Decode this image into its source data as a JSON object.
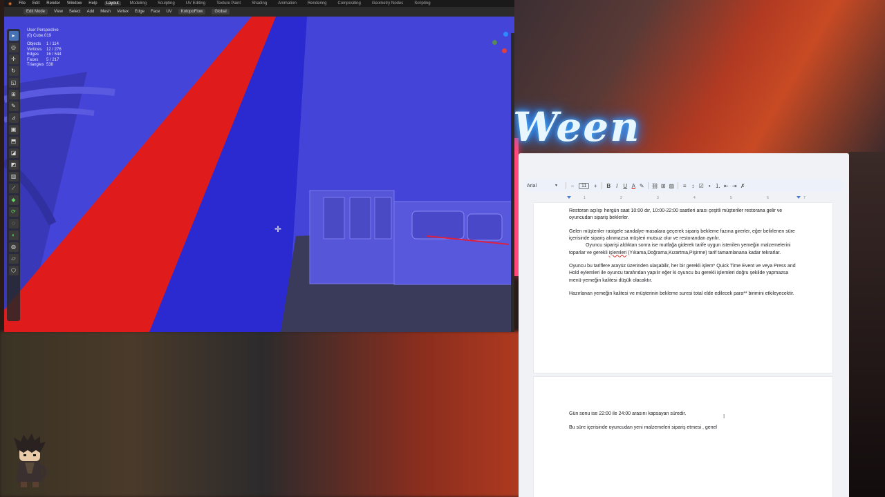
{
  "colors": {
    "viewport_blue": "#4444d8",
    "mesh_red": "#e01b1b",
    "docs_bg": "#f0f2f6",
    "neon_glow": "#2a8cff"
  },
  "overlay": {
    "neon_text": "Ween"
  },
  "blender": {
    "menu": [
      "File",
      "Edit",
      "Render",
      "Window",
      "Help"
    ],
    "workspaces": [
      "Layout",
      "Modeling",
      "Sculpting",
      "UV Editing",
      "Texture Paint",
      "Shading",
      "Animation",
      "Rendering",
      "Compositing",
      "Geometry Nodes",
      "Scripting"
    ],
    "active_workspace": "Layout",
    "header": {
      "mode": "Edit Mode",
      "menus": [
        "View",
        "Select",
        "Add",
        "Mesh",
        "Vertex",
        "Edge",
        "Face",
        "UV"
      ],
      "snap_pill": "KotopoFlow",
      "orientation": "Global"
    },
    "viewport_info": {
      "perspective": "User Perspective",
      "object_name": "(0) Cube.019",
      "stats": [
        {
          "label": "Objects",
          "value": "1 / 114"
        },
        {
          "label": "Vertices",
          "value": "12 / 276"
        },
        {
          "label": "Edges",
          "value": "16 / 544"
        },
        {
          "label": "Faces",
          "value": "5 / 217"
        },
        {
          "label": "Triangles",
          "value": "538"
        }
      ]
    },
    "tools": [
      "select-box-icon",
      "cursor-icon",
      "move-icon",
      "rotate-icon",
      "scale-icon",
      "transform-icon",
      "annotate-icon",
      "measure-icon",
      "add-cube-icon",
      "extrude-icon",
      "inset-icon",
      "bevel-icon",
      "loop-cut-icon",
      "knife-icon",
      "poly-build-icon",
      "spin-icon",
      "smooth-icon",
      "edge-slide-icon",
      "shrink-icon",
      "shear-icon",
      "rip-icon"
    ]
  },
  "docs": {
    "font": "Arial",
    "font_size": "11",
    "page1_paragraphs": [
      "Restoran açılışı hergün saat 10:00 dır, 10:00-22:00 saatleri arası çeşitli müşteriler restorana gelir ve oyuncudan sipariş beklerler.",
      "Gelen müşteriler rastgele sandalye-masalara geçerek sipariş bekleme fazına girerler, eğer belirlenen süre içerisinde sipariş alınmazsa müşteri mutsuz olur ve restorandan ayrılır.",
      "Oyuncu bu tariflere arayüz üzerinden ulaşabilir, her bir gerekli işlem* Quick Time Event ve veya Press and Hold eylemleri ile oyuncu tarafından yapılır eğer ki oyuncu bu gerekli işlemleri doğru şekilde yapmazsa  menü-yemeğin kalitesi düşük olacaktır.",
      "Hazırlanan yemeğin kalitesi ve müşterinin bekleme suresi total elde edilecek para** birimini etkileyecektir."
    ],
    "para2_line3_pre": "Oyuncu siparişi aldıktan sonra ise mutfağa giderek tarife uygun istenilen yemeğin malzemelerini toparlar ve gerekli ",
    "para2_line3_misspelled": "işlemleri",
    "para2_line3_post": " (Yıkama,Doğrama,Kızartma,Pişirme) tarif tamamlanana kadar tekrarlar.",
    "page2_paragraphs": [
      "Gün sonu ise 22:00 ile 24:00 arasını kapsayan süredir.",
      "Bu süre içerisinde oyuncudan yeni malzemeleri sipariş etmesi , genel"
    ],
    "ruler_ticks": [
      "1",
      "2",
      "3",
      "4",
      "5",
      "6",
      "7"
    ]
  }
}
